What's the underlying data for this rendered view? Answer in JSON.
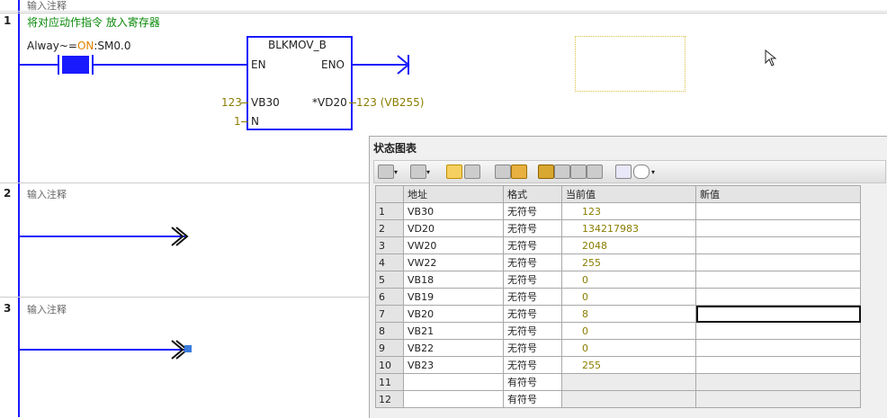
{
  "networks": [
    {
      "number": "1",
      "comment": "输入注释",
      "title": "将对应动作指令 放入寄存器"
    },
    {
      "number": "2",
      "comment": "输入注释"
    },
    {
      "number": "3",
      "comment": "输入注释"
    }
  ],
  "contact": {
    "label_prefix": "Alway~",
    "label_eq": "=",
    "label_on": "ON",
    "label_suffix": ":SM0.0"
  },
  "block": {
    "name": "BLKMOV_B",
    "en": "EN",
    "eno": "ENO",
    "in_value": "123",
    "in_operand": "VB30",
    "out_operand": "*VD20",
    "out_value": "123 (VB255)",
    "n_value": "1",
    "n_label": "N"
  },
  "status_chart": {
    "title": "状态图表",
    "columns": [
      "",
      "地址",
      "格式",
      "当前值",
      "新值"
    ],
    "rows": [
      {
        "n": "1",
        "addr": "VB30",
        "fmt": "无符号",
        "cur": "123",
        "new": ""
      },
      {
        "n": "2",
        "addr": "VD20",
        "fmt": "无符号",
        "cur": "134217983",
        "new": ""
      },
      {
        "n": "3",
        "addr": "VW20",
        "fmt": "无符号",
        "cur": "2048",
        "new": ""
      },
      {
        "n": "4",
        "addr": "VW22",
        "fmt": "无符号",
        "cur": "255",
        "new": ""
      },
      {
        "n": "5",
        "addr": "VB18",
        "fmt": "无符号",
        "cur": "0",
        "new": ""
      },
      {
        "n": "6",
        "addr": "VB19",
        "fmt": "无符号",
        "cur": "0",
        "new": ""
      },
      {
        "n": "7",
        "addr": "VB20",
        "fmt": "无符号",
        "cur": "8",
        "new": ""
      },
      {
        "n": "8",
        "addr": "VB21",
        "fmt": "无符号",
        "cur": "0",
        "new": ""
      },
      {
        "n": "9",
        "addr": "VB22",
        "fmt": "无符号",
        "cur": "0",
        "new": ""
      },
      {
        "n": "10",
        "addr": "VB23",
        "fmt": "无符号",
        "cur": "255",
        "new": ""
      },
      {
        "n": "11",
        "addr": "",
        "fmt": "有符号",
        "cur": "",
        "new": ""
      },
      {
        "n": "12",
        "addr": "",
        "fmt": "有符号",
        "cur": "",
        "new": ""
      }
    ]
  },
  "colors": {
    "rung": "#1a1aff",
    "status_value": "#8a7d00",
    "on_text": "#e08000",
    "title_green": "#0a8a0a"
  }
}
